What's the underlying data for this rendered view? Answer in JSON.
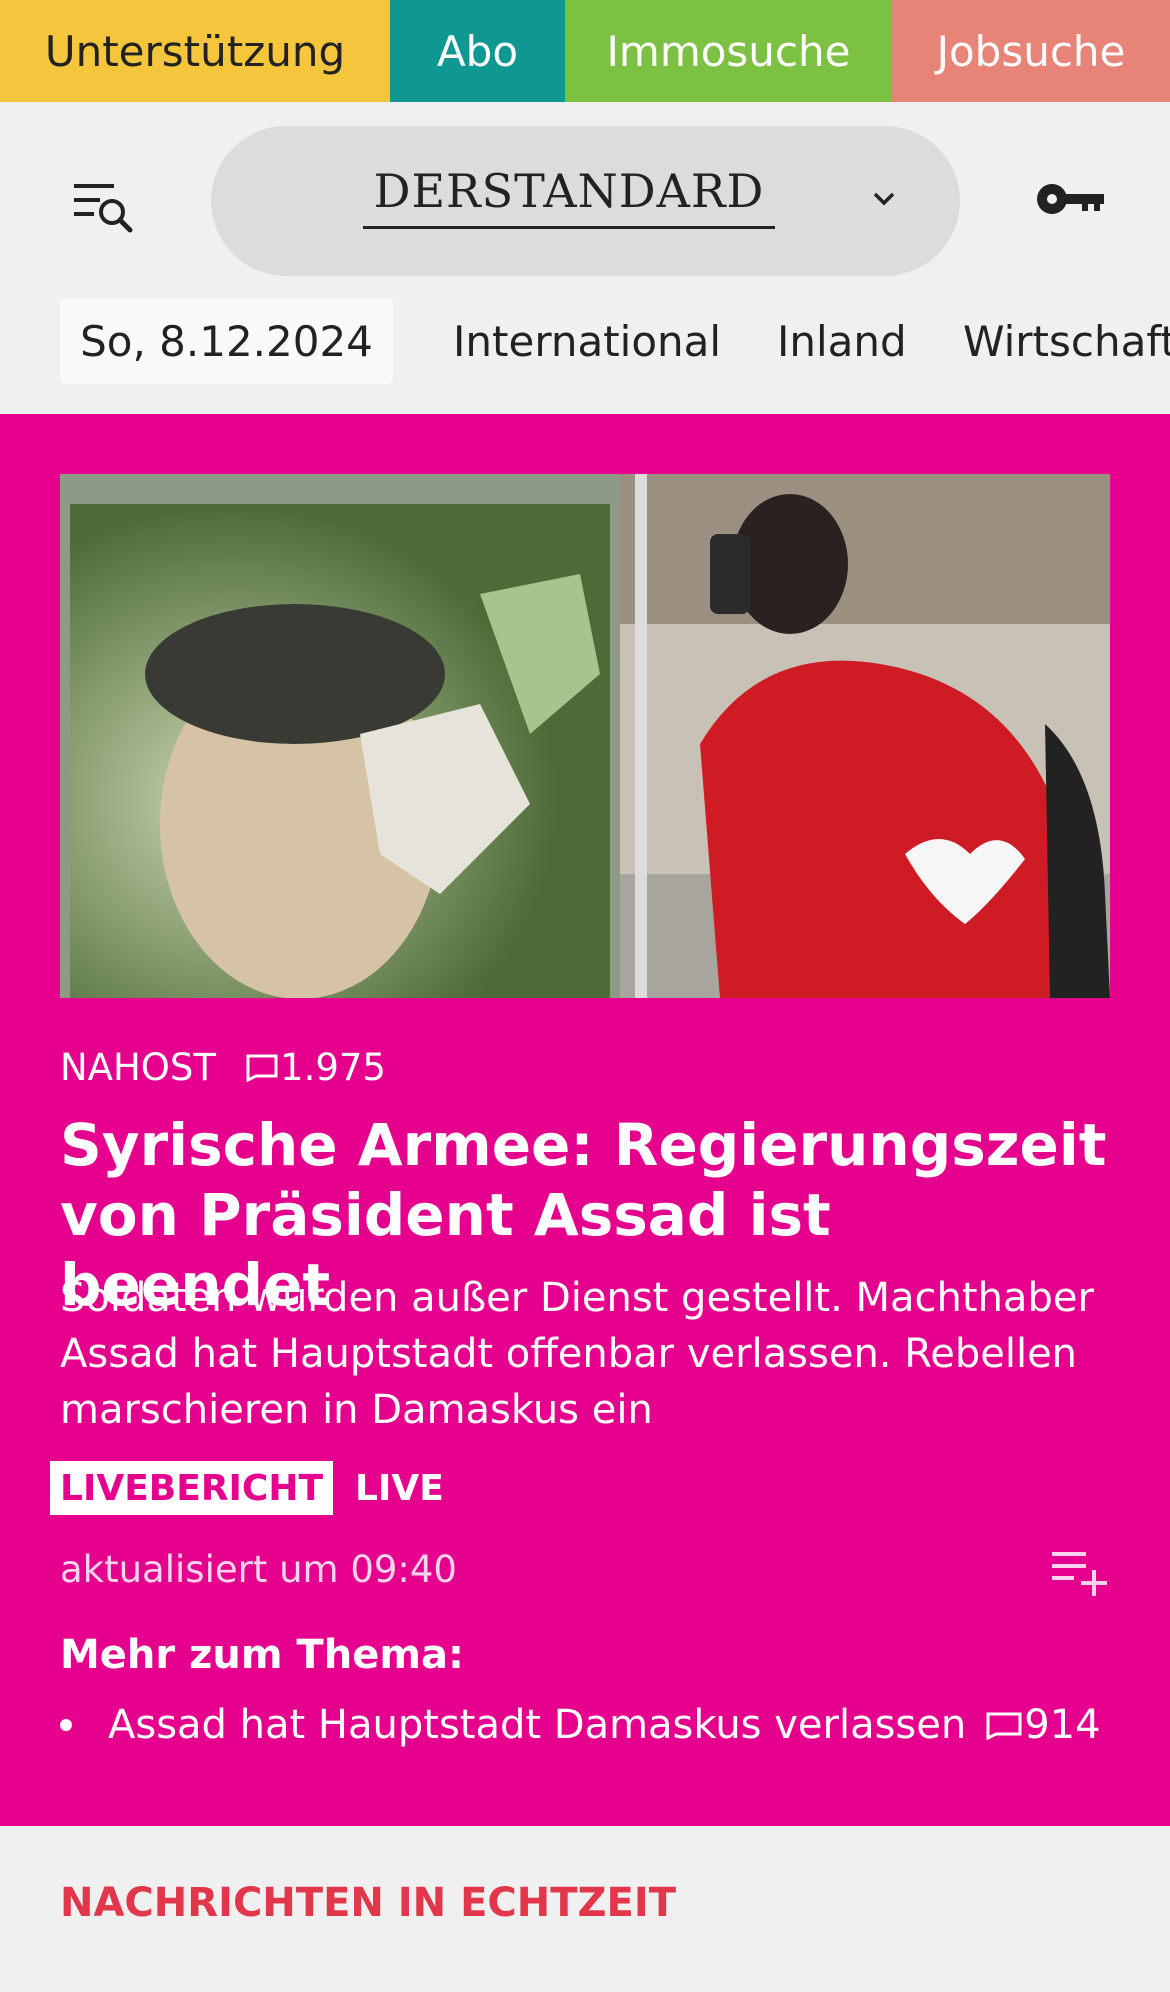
{
  "topnav": [
    {
      "label": "Unterstützung"
    },
    {
      "label": "Abo"
    },
    {
      "label": "Immosuche"
    },
    {
      "label": "Jobsuche"
    }
  ],
  "header": {
    "logo": "DERSTANDARD",
    "date": "So, 8.12.2024",
    "sections": [
      "International",
      "Inland",
      "Wirtschaft"
    ]
  },
  "hero": {
    "category": "NAHOST",
    "comments": "1.975",
    "headline": "Syrische Armee: Regierungszeit von Präsident Assad ist beendet",
    "lead": "Soldaten wurden außer Dienst gestellt. Machthaber Assad hat Hauptstadt offenbar verlassen. Rebellen marschieren in Damaskus ein",
    "live_badge": "LIVEBERICHT",
    "live_label": "LIVE",
    "updated": "aktualisiert um 09:40",
    "more_heading": "Mehr zum Thema:",
    "more_items": [
      {
        "title": "Assad hat Hauptstadt Damaskus verlassen",
        "comments": "914"
      }
    ]
  },
  "echtzeit": {
    "heading": "NACHRICHTEN IN ECHTZEIT"
  },
  "colors": {
    "hero_bg": "#e5008d",
    "support": "#f5c53b",
    "abo": "#0f9891",
    "immo": "#7cc142",
    "jobs": "#e88377",
    "echtzeit": "#e2364a"
  }
}
